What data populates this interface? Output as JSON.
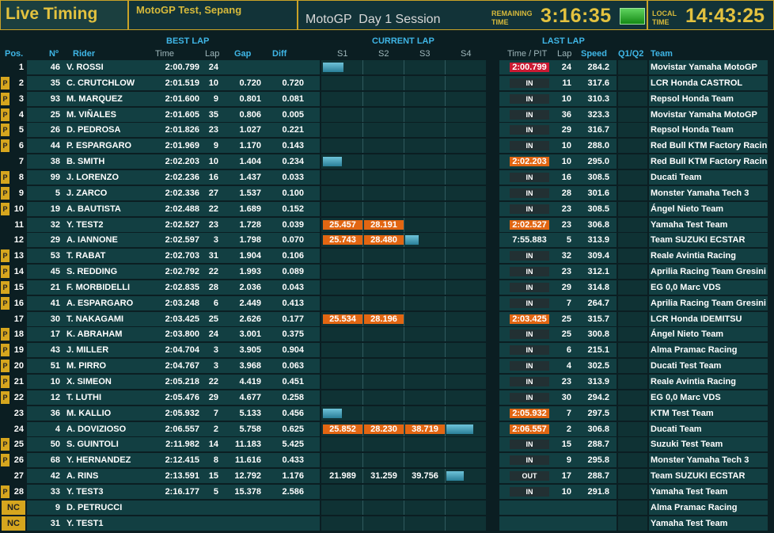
{
  "header": {
    "app_title": "Live Timing",
    "event": "MotoGP Test, Sepang",
    "session_class": "MotoGP",
    "session_name": "Day 1 Session",
    "remaining_label_1": "REMAINING",
    "remaining_label_2": "TIME",
    "remaining_time": "3:16:35",
    "local_label_1": "LOCAL",
    "local_label_2": "TIME",
    "local_time": "14:43:25"
  },
  "columns": {
    "pos": "Pos.",
    "num": "Nº",
    "rider": "Rider",
    "best_lap_group": "BEST LAP",
    "best_time": "Time",
    "best_lap": "Lap",
    "gap": "Gap",
    "diff": "Diff",
    "current_lap_group": "CURRENT LAP",
    "s1": "S1",
    "s2": "S2",
    "s3": "S3",
    "s4": "S4",
    "last_lap_group": "LAST LAP",
    "last_time": "Time / PIT",
    "last_lap": "Lap",
    "speed": "Speed",
    "q1q2": "Q1/Q2",
    "team": "Team"
  },
  "colors": {
    "row_bg": "#123f42",
    "row_bg_dark": "#0f3234",
    "header_text": "#3fb6e6",
    "accent_yellow": "#e3c23f",
    "sector_orange": "#e26612",
    "fastest_red": "#cc1a33",
    "pit_badge": "#d6a61e"
  },
  "rows": [
    {
      "pos": "1",
      "pit": "",
      "num": "46",
      "rider": "V. ROSSI",
      "best": "2:00.799",
      "lap": "24",
      "gap": "",
      "diff": "",
      "s1": "",
      "s2": "",
      "s3": "",
      "s1bar": 0.55,
      "s2bar": 0,
      "s3bar": 0,
      "s4bar": 0,
      "status": "2:00.799",
      "status_style": "red",
      "llap": "24",
      "speed": "284.2",
      "team": "Movistar Yamaha MotoGP"
    },
    {
      "pos": "2",
      "pit": "P",
      "num": "35",
      "rider": "C. CRUTCHLOW",
      "best": "2:01.519",
      "lap": "10",
      "gap": "0.720",
      "diff": "0.720",
      "s1": "",
      "s2": "",
      "s3": "",
      "s1bar": 0,
      "s2bar": 0,
      "s3bar": 0,
      "s4bar": 0,
      "status": "IN",
      "status_style": "dark",
      "llap": "11",
      "speed": "317.6",
      "team": "LCR Honda CASTROL"
    },
    {
      "pos": "3",
      "pit": "P",
      "num": "93",
      "rider": "M. MARQUEZ",
      "best": "2:01.600",
      "lap": "9",
      "gap": "0.801",
      "diff": "0.081",
      "s1": "",
      "s2": "",
      "s3": "",
      "s1bar": 0,
      "s2bar": 0,
      "s3bar": 0,
      "s4bar": 0,
      "status": "IN",
      "status_style": "dark",
      "llap": "10",
      "speed": "310.3",
      "team": "Repsol Honda Team"
    },
    {
      "pos": "4",
      "pit": "P",
      "num": "25",
      "rider": "M. VIÑALES",
      "best": "2:01.605",
      "lap": "35",
      "gap": "0.806",
      "diff": "0.005",
      "s1": "",
      "s2": "",
      "s3": "",
      "s1bar": 0,
      "s2bar": 0,
      "s3bar": 0,
      "s4bar": 0,
      "status": "IN",
      "status_style": "dark",
      "llap": "36",
      "speed": "323.3",
      "team": "Movistar Yamaha MotoGP"
    },
    {
      "pos": "5",
      "pit": "P",
      "num": "26",
      "rider": "D. PEDROSA",
      "best": "2:01.826",
      "lap": "23",
      "gap": "1.027",
      "diff": "0.221",
      "s1": "",
      "s2": "",
      "s3": "",
      "s1bar": 0,
      "s2bar": 0,
      "s3bar": 0,
      "s4bar": 0,
      "status": "IN",
      "status_style": "dark",
      "llap": "29",
      "speed": "316.7",
      "team": "Repsol Honda Team"
    },
    {
      "pos": "6",
      "pit": "P",
      "num": "44",
      "rider": "P. ESPARGARO",
      "best": "2:01.969",
      "lap": "9",
      "gap": "1.170",
      "diff": "0.143",
      "s1": "",
      "s2": "",
      "s3": "",
      "s1bar": 0,
      "s2bar": 0,
      "s3bar": 0,
      "s4bar": 0,
      "status": "IN",
      "status_style": "dark",
      "llap": "10",
      "speed": "288.0",
      "team": "Red Bull KTM Factory Racin"
    },
    {
      "pos": "7",
      "pit": "",
      "num": "38",
      "rider": "B. SMITH",
      "best": "2:02.203",
      "lap": "10",
      "gap": "1.404",
      "diff": "0.234",
      "s1": "",
      "s2": "",
      "s3": "",
      "s1bar": 0.5,
      "s2bar": 0,
      "s3bar": 0,
      "s4bar": 0,
      "status": "2:02.203",
      "status_style": "org",
      "llap": "10",
      "speed": "295.0",
      "team": "Red Bull KTM Factory Racin"
    },
    {
      "pos": "8",
      "pit": "P",
      "num": "99",
      "rider": "J. LORENZO",
      "best": "2:02.236",
      "lap": "16",
      "gap": "1.437",
      "diff": "0.033",
      "s1": "",
      "s2": "",
      "s3": "",
      "s1bar": 0,
      "s2bar": 0,
      "s3bar": 0,
      "s4bar": 0,
      "status": "IN",
      "status_style": "dark",
      "llap": "16",
      "speed": "308.5",
      "team": "Ducati Team"
    },
    {
      "pos": "9",
      "pit": "P",
      "num": "5",
      "rider": "J. ZARCO",
      "best": "2:02.336",
      "lap": "27",
      "gap": "1.537",
      "diff": "0.100",
      "s1": "",
      "s2": "",
      "s3": "",
      "s1bar": 0,
      "s2bar": 0,
      "s3bar": 0,
      "s4bar": 0,
      "status": "IN",
      "status_style": "dark",
      "llap": "28",
      "speed": "301.6",
      "team": "Monster Yamaha Tech 3"
    },
    {
      "pos": "10",
      "pit": "P",
      "num": "19",
      "rider": "A. BAUTISTA",
      "best": "2:02.488",
      "lap": "22",
      "gap": "1.689",
      "diff": "0.152",
      "s1": "",
      "s2": "",
      "s3": "",
      "s1bar": 0,
      "s2bar": 0,
      "s3bar": 0,
      "s4bar": 0,
      "status": "IN",
      "status_style": "dark",
      "llap": "23",
      "speed": "308.5",
      "team": "Ángel Nieto Team"
    },
    {
      "pos": "11",
      "pit": "",
      "num": "32",
      "rider": "Y. TEST2",
      "best": "2:02.527",
      "lap": "23",
      "gap": "1.728",
      "diff": "0.039",
      "s1": "25.457",
      "s2": "28.191",
      "s3": "",
      "s1bar": 0,
      "s2bar": 0,
      "s3bar": 0,
      "s4bar": 0,
      "status": "2:02.527",
      "status_style": "org",
      "llap": "23",
      "speed": "306.8",
      "team": "Yamaha Test Team"
    },
    {
      "pos": "12",
      "pit": "",
      "num": "29",
      "rider": "A. IANNONE",
      "best": "2:02.597",
      "lap": "3",
      "gap": "1.798",
      "diff": "0.070",
      "s1": "25.743",
      "s2": "28.480",
      "s3": "",
      "s1bar": 0,
      "s2bar": 0,
      "s3bar": 0.35,
      "s4bar": 0,
      "status": "7:55.883",
      "status_style": "plain",
      "llap": "5",
      "speed": "313.9",
      "team": "Team SUZUKI ECSTAR"
    },
    {
      "pos": "13",
      "pit": "P",
      "num": "53",
      "rider": "T. RABAT",
      "best": "2:02.703",
      "lap": "31",
      "gap": "1.904",
      "diff": "0.106",
      "s1": "",
      "s2": "",
      "s3": "",
      "s1bar": 0,
      "s2bar": 0,
      "s3bar": 0,
      "s4bar": 0,
      "status": "IN",
      "status_style": "dark",
      "llap": "32",
      "speed": "309.4",
      "team": "Reale Avintia Racing"
    },
    {
      "pos": "14",
      "pit": "P",
      "num": "45",
      "rider": "S. REDDING",
      "best": "2:02.792",
      "lap": "22",
      "gap": "1.993",
      "diff": "0.089",
      "s1": "",
      "s2": "",
      "s3": "",
      "s1bar": 0,
      "s2bar": 0,
      "s3bar": 0,
      "s4bar": 0,
      "status": "IN",
      "status_style": "dark",
      "llap": "23",
      "speed": "312.1",
      "team": "Aprilia Racing Team Gresini"
    },
    {
      "pos": "15",
      "pit": "P",
      "num": "21",
      "rider": "F. MORBIDELLI",
      "best": "2:02.835",
      "lap": "28",
      "gap": "2.036",
      "diff": "0.043",
      "s1": "",
      "s2": "",
      "s3": "",
      "s1bar": 0,
      "s2bar": 0,
      "s3bar": 0,
      "s4bar": 0,
      "status": "IN",
      "status_style": "dark",
      "llap": "29",
      "speed": "314.8",
      "team": "EG 0,0 Marc VDS"
    },
    {
      "pos": "16",
      "pit": "P",
      "num": "41",
      "rider": "A. ESPARGARO",
      "best": "2:03.248",
      "lap": "6",
      "gap": "2.449",
      "diff": "0.413",
      "s1": "",
      "s2": "",
      "s3": "",
      "s1bar": 0,
      "s2bar": 0,
      "s3bar": 0,
      "s4bar": 0,
      "status": "IN",
      "status_style": "dark",
      "llap": "7",
      "speed": "264.7",
      "team": "Aprilia Racing Team Gresini"
    },
    {
      "pos": "17",
      "pit": "",
      "num": "30",
      "rider": "T. NAKAGAMI",
      "best": "2:03.425",
      "lap": "25",
      "gap": "2.626",
      "diff": "0.177",
      "s1": "25.534",
      "s2": "28.196",
      "s3": "",
      "s1bar": 0,
      "s2bar": 0,
      "s3bar": 0,
      "s4bar": 0,
      "status": "2:03.425",
      "status_style": "org",
      "llap": "25",
      "speed": "315.7",
      "team": "LCR Honda IDEMITSU"
    },
    {
      "pos": "18",
      "pit": "P",
      "num": "17",
      "rider": "K. ABRAHAM",
      "best": "2:03.800",
      "lap": "24",
      "gap": "3.001",
      "diff": "0.375",
      "s1": "",
      "s2": "",
      "s3": "",
      "s1bar": 0,
      "s2bar": 0,
      "s3bar": 0,
      "s4bar": 0,
      "status": "IN",
      "status_style": "dark",
      "llap": "25",
      "speed": "300.8",
      "team": "Ángel Nieto Team"
    },
    {
      "pos": "19",
      "pit": "P",
      "num": "43",
      "rider": "J. MILLER",
      "best": "2:04.704",
      "lap": "3",
      "gap": "3.905",
      "diff": "0.904",
      "s1": "",
      "s2": "",
      "s3": "",
      "s1bar": 0,
      "s2bar": 0,
      "s3bar": 0,
      "s4bar": 0,
      "status": "IN",
      "status_style": "dark",
      "llap": "6",
      "speed": "215.1",
      "team": "Alma Pramac Racing"
    },
    {
      "pos": "20",
      "pit": "P",
      "num": "51",
      "rider": "M. PIRRO",
      "best": "2:04.767",
      "lap": "3",
      "gap": "3.968",
      "diff": "0.063",
      "s1": "",
      "s2": "",
      "s3": "",
      "s1bar": 0,
      "s2bar": 0,
      "s3bar": 0,
      "s4bar": 0,
      "status": "IN",
      "status_style": "dark",
      "llap": "4",
      "speed": "302.5",
      "team": "Ducati Test Team"
    },
    {
      "pos": "21",
      "pit": "P",
      "num": "10",
      "rider": "X. SIMEON",
      "best": "2:05.218",
      "lap": "22",
      "gap": "4.419",
      "diff": "0.451",
      "s1": "",
      "s2": "",
      "s3": "",
      "s1bar": 0,
      "s2bar": 0,
      "s3bar": 0,
      "s4bar": 0,
      "status": "IN",
      "status_style": "dark",
      "llap": "23",
      "speed": "313.9",
      "team": "Reale Avintia Racing"
    },
    {
      "pos": "22",
      "pit": "P",
      "num": "12",
      "rider": "T. LUTHI",
      "best": "2:05.476",
      "lap": "29",
      "gap": "4.677",
      "diff": "0.258",
      "s1": "",
      "s2": "",
      "s3": "",
      "s1bar": 0,
      "s2bar": 0,
      "s3bar": 0,
      "s4bar": 0,
      "status": "IN",
      "status_style": "dark",
      "llap": "30",
      "speed": "294.2",
      "team": "EG 0,0 Marc VDS"
    },
    {
      "pos": "23",
      "pit": "",
      "num": "36",
      "rider": "M. KALLIO",
      "best": "2:05.932",
      "lap": "7",
      "gap": "5.133",
      "diff": "0.456",
      "s1": "",
      "s2": "",
      "s3": "",
      "s1bar": 0.5,
      "s2bar": 0,
      "s3bar": 0,
      "s4bar": 0,
      "status": "2:05.932",
      "status_style": "org",
      "llap": "7",
      "speed": "297.5",
      "team": "KTM Test Team"
    },
    {
      "pos": "24",
      "pit": "",
      "num": "4",
      "rider": "A. DOVIZIOSO",
      "best": "2:06.557",
      "lap": "2",
      "gap": "5.758",
      "diff": "0.625",
      "s1": "25.852",
      "s2": "28.230",
      "s3": "38.719",
      "s1bar": 0,
      "s2bar": 0,
      "s3bar": 0,
      "s4bar": 0.7,
      "status": "2:06.557",
      "status_style": "org",
      "llap": "2",
      "speed": "306.8",
      "team": "Ducati Team"
    },
    {
      "pos": "25",
      "pit": "P",
      "num": "50",
      "rider": "S. GUINTOLI",
      "best": "2:11.982",
      "lap": "14",
      "gap": "11.183",
      "diff": "5.425",
      "s1": "",
      "s2": "",
      "s3": "",
      "s1bar": 0,
      "s2bar": 0,
      "s3bar": 0,
      "s4bar": 0,
      "status": "IN",
      "status_style": "dark",
      "llap": "15",
      "speed": "288.7",
      "team": "Suzuki Test Team"
    },
    {
      "pos": "26",
      "pit": "P",
      "num": "68",
      "rider": "Y. HERNANDEZ",
      "best": "2:12.415",
      "lap": "8",
      "gap": "11.616",
      "diff": "0.433",
      "s1": "",
      "s2": "",
      "s3": "",
      "s1bar": 0,
      "s2bar": 0,
      "s3bar": 0,
      "s4bar": 0,
      "status": "IN",
      "status_style": "dark",
      "llap": "9",
      "speed": "295.8",
      "team": "Monster Yamaha Tech 3"
    },
    {
      "pos": "27",
      "pit": "",
      "num": "42",
      "rider": "A. RINS",
      "best": "2:13.591",
      "lap": "15",
      "gap": "12.792",
      "diff": "1.176",
      "s1": "21.989",
      "s2": "31.259",
      "s3": "39.756",
      "s1bar": 0,
      "s2bar": 0,
      "s3bar": 0,
      "s4bar": 0.45,
      "status": "OUT",
      "status_style": "dark",
      "llap": "17",
      "speed": "288.7",
      "team": "Team SUZUKI ECSTAR"
    },
    {
      "pos": "28",
      "pit": "P",
      "num": "33",
      "rider": "Y. TEST3",
      "best": "2:16.177",
      "lap": "5",
      "gap": "15.378",
      "diff": "2.586",
      "s1": "",
      "s2": "",
      "s3": "",
      "s1bar": 0,
      "s2bar": 0,
      "s3bar": 0,
      "s4bar": 0,
      "status": "IN",
      "status_style": "dark",
      "llap": "10",
      "speed": "291.8",
      "team": "Yamaha Test Team"
    },
    {
      "pos": "NC",
      "pit": "",
      "num": "9",
      "rider": "D. PETRUCCI",
      "best": "",
      "lap": "",
      "gap": "",
      "diff": "",
      "s1": "",
      "s2": "",
      "s3": "",
      "s1bar": 0,
      "s2bar": 0,
      "s3bar": 0,
      "s4bar": 0,
      "status": "",
      "status_style": "plain",
      "llap": "",
      "speed": "",
      "team": "Alma Pramac Racing"
    },
    {
      "pos": "NC",
      "pit": "",
      "num": "31",
      "rider": "Y. TEST1",
      "best": "",
      "lap": "",
      "gap": "",
      "diff": "",
      "s1": "",
      "s2": "",
      "s3": "",
      "s1bar": 0,
      "s2bar": 0,
      "s3bar": 0,
      "s4bar": 0,
      "status": "",
      "status_style": "plain",
      "llap": "",
      "speed": "",
      "team": "Yamaha Test Team"
    }
  ]
}
